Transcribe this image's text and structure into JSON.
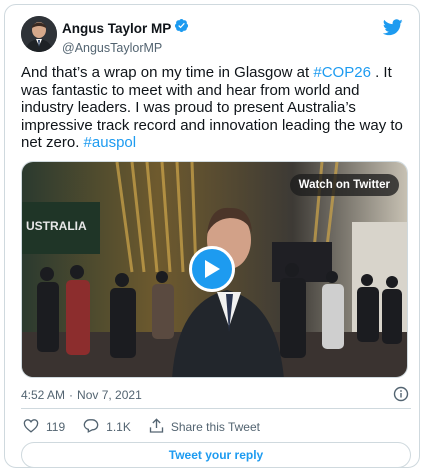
{
  "author": {
    "display_name": "Angus Taylor MP",
    "handle": "@AngusTaylorMP",
    "verified": true
  },
  "tweet": {
    "text_before_tag1": "And that’s a wrap on my time in Glasgow at ",
    "hashtag1": "#COP26",
    "text_middle": " . It was fantastic to meet with and hear from world and industry leaders. I was proud to present Australia’s impressive track record and innovation leading the way to net zero. ",
    "hashtag2": "#auspol"
  },
  "media": {
    "watch_label": "Watch on Twitter",
    "banner_text": "USTRALIA"
  },
  "meta": {
    "time": "4:52 AM",
    "separator": "·",
    "date": "Nov 7, 2021"
  },
  "actions": {
    "likes": "119",
    "replies": "1.1K",
    "share_label": "Share this Tweet"
  },
  "reply_button_label": "Tweet your reply",
  "colors": {
    "accent": "#1d9bf0",
    "like": "#f91880",
    "muted": "#536471"
  },
  "icons": [
    "verified-badge-icon",
    "twitter-bird-icon",
    "play-icon",
    "info-icon",
    "heart-icon",
    "reply-icon",
    "share-icon"
  ]
}
